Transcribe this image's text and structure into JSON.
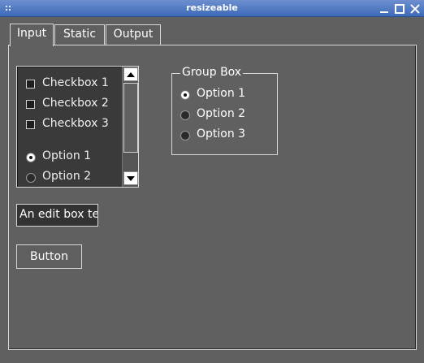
{
  "window": {
    "title": "resizeable",
    "controls": [
      "minimize-icon",
      "maximize-icon",
      "close-icon"
    ]
  },
  "tabs": [
    {
      "label": "Input",
      "active": true
    },
    {
      "label": "Static",
      "active": false
    },
    {
      "label": "Output",
      "active": false
    }
  ],
  "listbox": {
    "items": [
      {
        "type": "checkbox",
        "label": "Checkbox 1",
        "checked": false
      },
      {
        "type": "checkbox",
        "label": "Checkbox 2",
        "checked": false
      },
      {
        "type": "checkbox",
        "label": "Checkbox 3",
        "checked": false
      },
      {
        "type": "radio",
        "label": "Option 1",
        "selected": true
      },
      {
        "type": "radio",
        "label": "Option 2",
        "selected": false
      }
    ]
  },
  "group_box": {
    "title": "Group Box",
    "options": [
      {
        "label": "Option 1",
        "selected": true
      },
      {
        "label": "Option 2",
        "selected": false
      },
      {
        "label": "Option 3",
        "selected": false
      }
    ]
  },
  "edit_box": {
    "value": "An edit box te"
  },
  "button": {
    "label": "Button"
  },
  "colors": {
    "titlebar": "#3d6ab8",
    "background": "#606060",
    "listbox_bg": "#3a3a3a"
  }
}
